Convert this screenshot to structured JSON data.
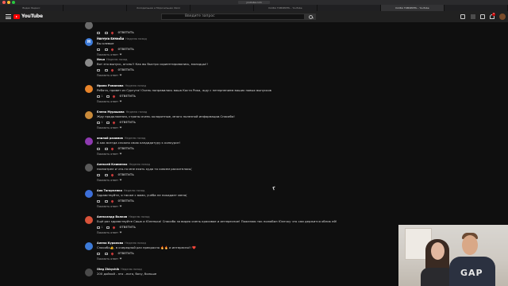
{
  "browser": {
    "tabs": [
      "Видео Яндекс",
      "",
      "Холодильник и Морозильник Хёлл",
      "",
      "КАЖА ГОВОРИТЬ - YouTube",
      "",
      "КАЖА ГОВОРИТЬ - YouTube",
      ""
    ],
    "active_tab": 6,
    "url": "youtube.com"
  },
  "header": {
    "brand": "YouTube",
    "search_placeholder": "Введите запрос",
    "notification_count": "9"
  },
  "comments": [
    {
      "author": "",
      "time": "",
      "text": "",
      "likes": "",
      "reply_label": "ОТВЕТИТЬ",
      "show_replies": "Показать ответ",
      "avatar_color": "#6b6b6b",
      "avatar_letter": ""
    },
    {
      "author": "Настуся Белевой",
      "time": "Неделю назад",
      "text": "Вы клевые",
      "likes": "",
      "reply_label": "ОТВЕТИТЬ",
      "show_replies": "Показать ответ",
      "avatar_color": "#3d7bd9",
      "avatar_letter": "Н"
    },
    {
      "author": "Илья",
      "time": "Неделю назад",
      "text": "Вот это выпуск, огонь!! Как вы быстро сориентировались, молодцы!!",
      "likes": "",
      "reply_label": "ОТВЕТИТЬ",
      "show_replies": "Показать ответ",
      "avatar_color": "#8a8a8a",
      "avatar_letter": ""
    },
    {
      "author": "Ирина Романова",
      "time": "Неделю назад",
      "text": "Ребята, привет из Сургута! Очень понравилась ваша Коста Рика, жду с нетерпением ваших новых выпусков",
      "likes": "1",
      "reply_label": "ОТВЕТИТЬ",
      "show_replies": "Показать ответ",
      "avatar_color": "#e8842a",
      "avatar_letter": ""
    },
    {
      "author": "Елена Мурашова",
      "time": "Неделю назад",
      "text": "Жду продолжения, страны очень колоритные, много полезной информации.Спасибо!",
      "likes": "1",
      "reply_label": "ОТВЕТИТЬ",
      "show_replies": "Показать ответ",
      "avatar_color": "#c98a3a",
      "avatar_letter": ""
    },
    {
      "author": "анилай рахимов",
      "time": "Неделю назад",
      "text": "А как всегда сложно свою кандидатуру к конкурсе!",
      "likes": "",
      "reply_label": "ОТВЕТИТЬ",
      "show_replies": "Показать ответ",
      "avatar_color": "#8e3ab0",
      "avatar_letter": ""
    },
    {
      "author": "Алексей Клименко",
      "time": "Неделю назад",
      "text": "посмотрел и что-то мне ехать куда то совсем расхотелось(",
      "likes": "",
      "reply_label": "ОТВЕТИТЬ",
      "show_replies": "Показать ответ",
      "avatar_color": "#5a5a5a",
      "avatar_letter": ""
    },
    {
      "author": "Аня Тягарченко",
      "time": "Неделю назад",
      "text": "Здравствуйте, я также с вами, учёба не покидает меня(",
      "likes": "",
      "reply_label": "ОТВЕТИТЬ",
      "show_replies": "Показать ответ",
      "avatar_color": "#3d6fd9",
      "avatar_letter": ""
    },
    {
      "author": "Александр Волков",
      "time": "Неделю назад",
      "text": "Ещё раз здравствуйте Саша и Юленька! Спасибо за видео очень красивое и интересное! Пожелаю так полюбил Юлечку что сам держится облик ей!",
      "likes": "1",
      "reply_label": "ОТВЕТИТЬ",
      "show_replies": "Показать ответ",
      "avatar_color": "#d9533a",
      "avatar_letter": ""
    },
    {
      "author": "Алена Курилова",
      "time": "Неделю назад",
      "text": "Спасибо👍, в очередной раз прекрасно 🔥🔥 и интересно!! ❤️",
      "likes": "",
      "reply_label": "ОТВЕТИТЬ",
      "show_replies": "Показать ответ",
      "avatar_color": "#3d7bd9",
      "avatar_letter": ""
    },
    {
      "author": "Oleg Zhbychik",
      "time": "Неделю назад",
      "text": "200 дойхой - это ..ного, бочу, больше",
      "likes": "",
      "reply_label": "",
      "show_replies": "",
      "avatar_color": "#4a4a4a",
      "avatar_letter": ""
    }
  ]
}
